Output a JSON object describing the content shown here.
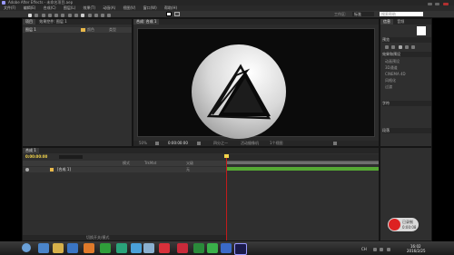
{
  "title_bar": {
    "title": "Adobe After Effects - 未命名项目.aep"
  },
  "menu": [
    "文件(F)",
    "编辑(E)",
    "合成(C)",
    "图层(L)",
    "效果(T)",
    "动画(A)",
    "视图(V)",
    "窗口(W)",
    "帮助(H)"
  ],
  "toolbar": {
    "workspace_label": "工作区:",
    "workspace_value": "标准",
    "search_placeholder": "搜索帮助"
  },
  "project_panel": {
    "tabs": [
      "项目",
      "效果控件: 图层 1"
    ],
    "item_name": "图层 1",
    "col1": "颜色",
    "col2": "类型"
  },
  "comp_panel": {
    "tab": "合成: 合成 1",
    "footer": {
      "zoom": "50%",
      "timecode": "0:00:00:00",
      "resolution": "四分之一",
      "camera": "活动摄像机",
      "views": "1个视图"
    }
  },
  "right_panel": {
    "tabs": [
      "信息",
      "音频"
    ],
    "sections": [
      "预览",
      "效果和预设",
      "字符",
      "段落"
    ],
    "preset_labels": [
      "动画预设",
      "3D通道",
      "CINEMA 4D",
      "风格化",
      "过渡"
    ]
  },
  "timeline": {
    "tab": "合成 1",
    "timecode": "0:00:00:00",
    "layer_name": "[合成 1]",
    "col_mode": "模式",
    "col_trkmat": "TrkMat",
    "col_parent": "父级",
    "parent_value": "无",
    "footer": "切换开关/模式"
  },
  "recorder_badge": {
    "line1": "已录制",
    "line2": "0:00:08"
  },
  "clock": {
    "time": "16:02",
    "date": "2016/2/25"
  },
  "tray": {
    "language": "CH"
  },
  "colors": {
    "accent": "#e8b84a",
    "playhead": "#c21b1b",
    "timecode": "#f2d44a",
    "green_bar": "#55a834",
    "logo_red": "#e0202c"
  }
}
